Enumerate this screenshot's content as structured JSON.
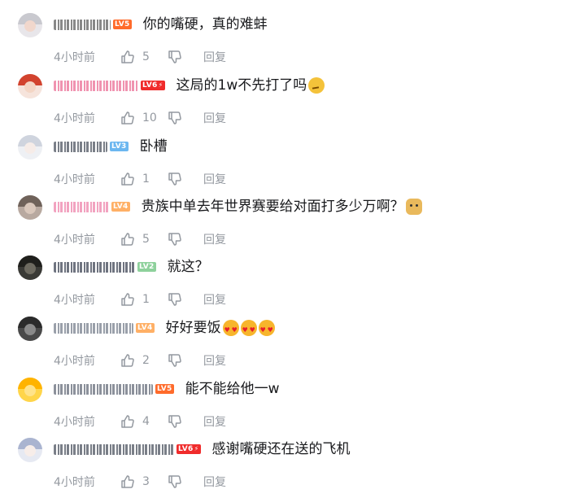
{
  "labels": {
    "time": "4小时前",
    "reply": "回复"
  },
  "comments": [
    {
      "text": "你的嘴硬，真的难蚌",
      "likes": "5",
      "level": "LV5",
      "level_color": "#ff6b2b",
      "spark": false,
      "name_width": 70,
      "name_color": "#888888",
      "emoji": [],
      "avatar_bg": "#e8e6ea",
      "hair": "#c9c9cf",
      "face": "#f1d7cc"
    },
    {
      "text": "这局的1w不先打了吗",
      "likes": "10",
      "level": "LV6",
      "level_color": "#f02b2b",
      "spark": true,
      "name_width": 104,
      "name_color": "#f093b0",
      "emoji": [
        "think"
      ],
      "avatar_bg": "#f6e4dc",
      "hair": "#d2432e",
      "face": "#f4d6c5"
    },
    {
      "text": "卧槽",
      "likes": "1",
      "level": "LV3",
      "level_color": "#6cb7f0",
      "spark": false,
      "name_width": 66,
      "name_color": "#7a7f88",
      "emoji": [],
      "avatar_bg": "#eef0f4",
      "hair": "#cfd4de",
      "face": "#f6ece8"
    },
    {
      "text": "贵族中单去年世界赛要给对面打多少万啊？",
      "likes": "5",
      "level": "LV4",
      "level_color": "#ffb066",
      "spark": false,
      "name_width": 68,
      "name_color": "#f2a3c0",
      "emoji": [
        "doge"
      ],
      "avatar_bg": "#b8a9a0",
      "hair": "#6f625a",
      "face": "#d9c7bb"
    },
    {
      "text": "就这？",
      "likes": "1",
      "level": "LV2",
      "level_color": "#8ed19c",
      "spark": false,
      "name_width": 100,
      "name_color": "#6f7480",
      "emoji": [],
      "avatar_bg": "#3a3a36",
      "hair": "#1f1f1c",
      "face": "#6d6a60"
    },
    {
      "text": "好好要饭",
      "likes": "2",
      "level": "LV4",
      "level_color": "#ffb066",
      "spark": false,
      "name_width": 98,
      "name_color": "#9aa0aa",
      "emoji": [
        "love",
        "love",
        "love"
      ],
      "avatar_bg": "#4a4a4a",
      "hair": "#2b2b2b",
      "face": "#8a8a8a"
    },
    {
      "text": "能不能给他一w",
      "likes": "4",
      "level": "LV5",
      "level_color": "#ff6b2b",
      "spark": false,
      "name_width": 122,
      "name_color": "#8c919b",
      "emoji": [],
      "avatar_bg": "#ffd54a",
      "hair": "#ffb300",
      "face": "#ffe38a"
    },
    {
      "text": "感谢嘴硬还在送的飞机",
      "likes": "3",
      "level": "LV6",
      "level_color": "#f02b2b",
      "spark": true,
      "name_width": 148,
      "name_color": "#7a7f88",
      "emoji": [],
      "avatar_bg": "#e6e9f2",
      "hair": "#aab4d0",
      "face": "#f7ede9"
    }
  ]
}
